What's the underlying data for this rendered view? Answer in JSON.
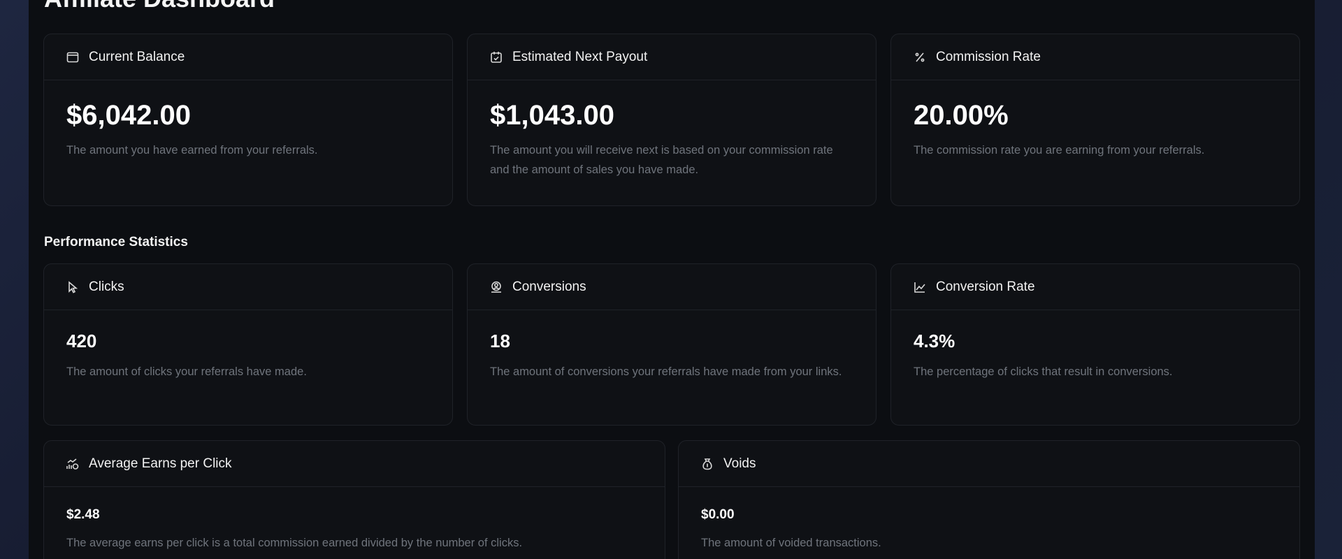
{
  "page": {
    "title": "Affiliate Dashboard"
  },
  "summary_cards": [
    {
      "icon": "wallet-icon",
      "label": "Current Balance",
      "value": "$6,042.00",
      "description": "The amount you have earned from your referrals."
    },
    {
      "icon": "calendar-check-icon",
      "label": "Estimated Next Payout",
      "value": "$1,043.00",
      "description": "The amount you will receive next is based on your commission rate and the amount of sales you have made."
    },
    {
      "icon": "percent-icon",
      "label": "Commission Rate",
      "value": "20.00%",
      "description": "The commission rate you are earning from your referrals."
    }
  ],
  "performance": {
    "title": "Performance Statistics",
    "cards": [
      {
        "icon": "cursor-pointer-icon",
        "label": "Clicks",
        "value": "420",
        "description": "The amount of clicks your referrals have made."
      },
      {
        "icon": "user-badge-icon",
        "label": "Conversions",
        "value": "18",
        "description": "The amount of conversions your referrals have made from your links."
      },
      {
        "icon": "line-chart-icon",
        "label": "Conversion Rate",
        "value": "4.3%",
        "description": "The percentage of clicks that result in conversions."
      }
    ]
  },
  "bottom_cards": [
    {
      "icon": "coins-chart-icon",
      "label": "Average Earns per Click",
      "value": "$2.48",
      "description": "The average earns per click is a total commission earned divided by the number of clicks."
    },
    {
      "icon": "money-bag-icon",
      "label": "Voids",
      "value": "$0.00",
      "description": "The amount of voided transactions."
    }
  ]
}
